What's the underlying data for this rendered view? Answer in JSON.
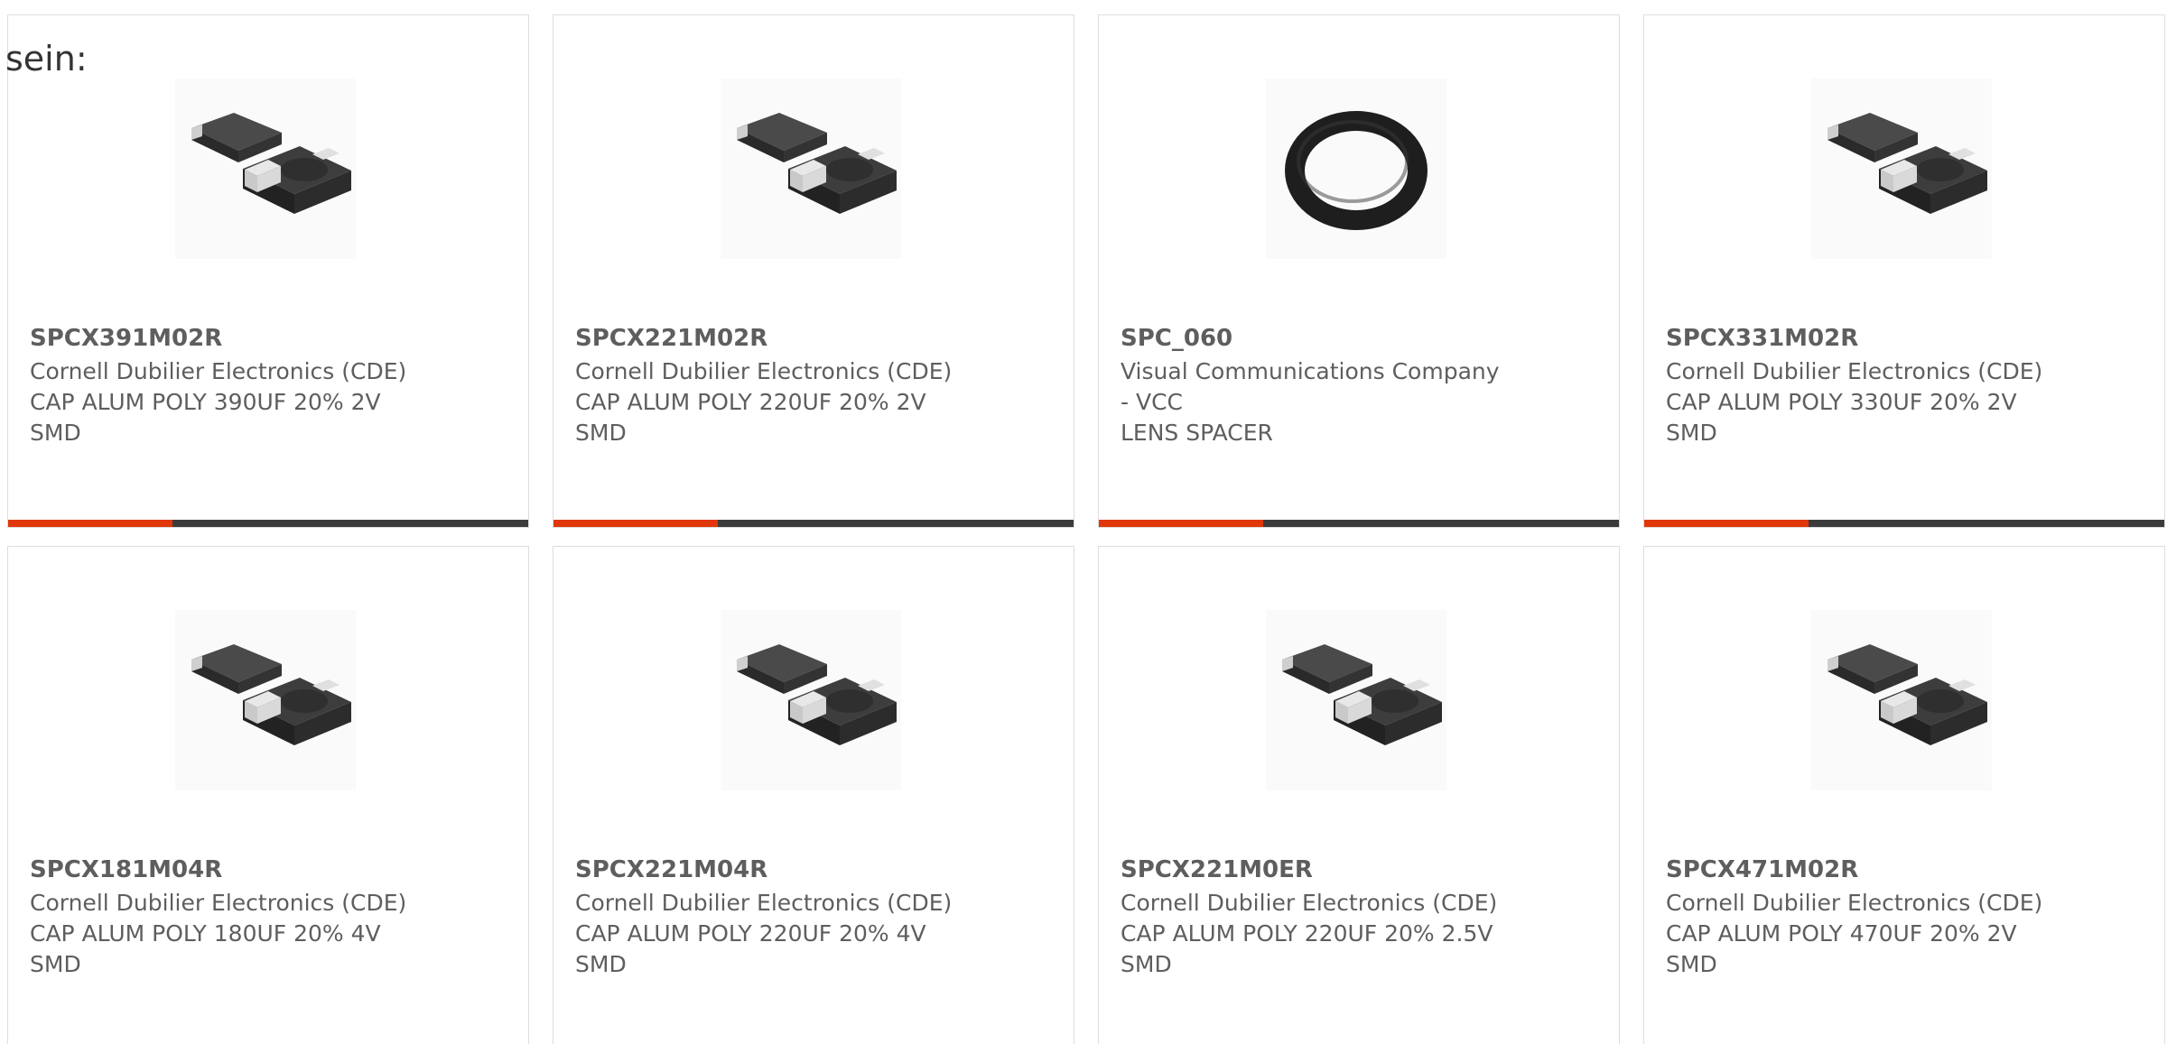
{
  "intro_text": "sein:",
  "colors": {
    "accent": "#e0380a",
    "bar": "#3c3c3c",
    "text": "#5e5e5e"
  },
  "products": [
    {
      "part_number": "SPCX391M02R",
      "manufacturer": "Cornell Dubilier Electronics (CDE)",
      "description": "CAP ALUM POLY 390UF 20% 2V",
      "description_2": "SMD",
      "image": "smd-capacitor-icon"
    },
    {
      "part_number": "SPCX221M02R",
      "manufacturer": "Cornell Dubilier Electronics (CDE)",
      "description": "CAP ALUM POLY 220UF 20% 2V",
      "description_2": "SMD",
      "image": "smd-capacitor-icon"
    },
    {
      "part_number": "SPC_060",
      "manufacturer": "Visual Communications Company",
      "manufacturer_2": "- VCC",
      "description": "LENS SPACER",
      "image": "o-ring-icon"
    },
    {
      "part_number": "SPCX331M02R",
      "manufacturer": "Cornell Dubilier Electronics (CDE)",
      "description": "CAP ALUM POLY 330UF 20% 2V",
      "description_2": "SMD",
      "image": "smd-capacitor-icon"
    },
    {
      "part_number": "SPCX181M04R",
      "manufacturer": "Cornell Dubilier Electronics (CDE)",
      "description": "CAP ALUM POLY 180UF 20% 4V",
      "description_2": "SMD",
      "image": "smd-capacitor-icon"
    },
    {
      "part_number": "SPCX221M04R",
      "manufacturer": "Cornell Dubilier Electronics (CDE)",
      "description": "CAP ALUM POLY 220UF 20% 4V",
      "description_2": "SMD",
      "image": "smd-capacitor-icon"
    },
    {
      "part_number": "SPCX221M0ER",
      "manufacturer": "Cornell Dubilier Electronics (CDE)",
      "description": "CAP ALUM POLY 220UF 20% 2.5V",
      "description_2": "SMD",
      "image": "smd-capacitor-icon"
    },
    {
      "part_number": "SPCX471M02R",
      "manufacturer": "Cornell Dubilier Electronics (CDE)",
      "description": "CAP ALUM POLY 470UF 20% 2V",
      "description_2": "SMD",
      "image": "smd-capacitor-icon"
    }
  ]
}
